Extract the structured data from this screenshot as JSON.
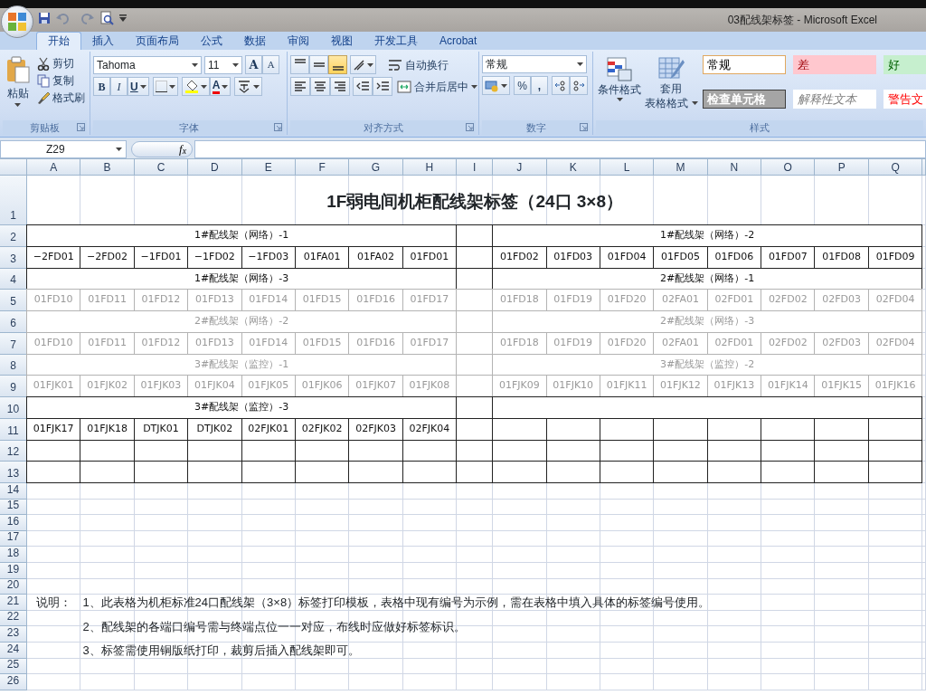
{
  "title_bar": {
    "title": "03配线架标签 - Microsoft Excel"
  },
  "ribbon_tabs": [
    {
      "label": "开始",
      "selected": true
    },
    {
      "label": "插入",
      "selected": false
    },
    {
      "label": "页面布局",
      "selected": false
    },
    {
      "label": "公式",
      "selected": false
    },
    {
      "label": "数据",
      "selected": false
    },
    {
      "label": "审阅",
      "selected": false
    },
    {
      "label": "视图",
      "selected": false
    },
    {
      "label": "开发工具",
      "selected": false
    },
    {
      "label": "Acrobat",
      "selected": false
    }
  ],
  "clipboard": {
    "paste": "粘贴",
    "cut": "剪切",
    "copy": "复制",
    "format_painter": "格式刷",
    "group_label": "剪贴板"
  },
  "font": {
    "font_name": "Tahoma",
    "font_size": "11",
    "grow": "A",
    "shrink": "A",
    "bold": "B",
    "italic": "I",
    "underline": "U",
    "font_color": "A",
    "group_label": "字体"
  },
  "alignment": {
    "vertical_align": [
      {
        "selected": false
      },
      {
        "selected": false
      },
      {
        "selected": true
      }
    ],
    "wrap_text": "自动换行",
    "merge_center": "合并后居中",
    "group_label": "对齐方式"
  },
  "number": {
    "format": "常规",
    "percent": "%",
    "comma": ",",
    "group_label": "数字"
  },
  "styles": {
    "conditional_formatting": "条件格式",
    "format_as_table": [
      "套用",
      "表格格式"
    ],
    "cell_styles": [
      {
        "label": "常规",
        "kind": "normal"
      },
      {
        "label": "差",
        "kind": "bad"
      },
      {
        "label": "好",
        "kind": "good"
      },
      {
        "label": "检查单元格",
        "kind": "check"
      },
      {
        "label": "解释性文本",
        "kind": "explanatory"
      },
      {
        "label": "警告文",
        "kind": "warning"
      }
    ],
    "group_label": "样式"
  },
  "formula_bar": {
    "name_box": "Z29",
    "fx": "f$_{x}$"
  },
  "sheet": {
    "columns": [
      "A",
      "B",
      "C",
      "D",
      "E",
      "F",
      "G",
      "H",
      "I",
      "J",
      "K",
      "L",
      "M",
      "N",
      "O",
      "P",
      "Q"
    ],
    "row_numbers": [
      "1",
      "2",
      "3",
      "4",
      "5",
      "6",
      "7",
      "8",
      "9",
      "10",
      "11",
      "12",
      "13",
      "14",
      "15",
      "16",
      "17",
      "18",
      "19",
      "20",
      "21",
      "22",
      "23",
      "24",
      "25",
      "26"
    ],
    "title": "1F弱电间机柜配线架标签（24口 3×8）",
    "rows": [
      {
        "kind": "header",
        "faded": false,
        "left": "1#配线架（网络）-1",
        "right": "1#配线架（网络）-2"
      },
      {
        "kind": "labels",
        "faded": false,
        "left": [
          "−2FD01",
          "−2FD02",
          "−1FD01",
          "−1FD02",
          "−1FD03",
          "01FA01",
          "01FA02",
          "01FD01"
        ],
        "right": [
          "01FD02",
          "01FD03",
          "01FD04",
          "01FD05",
          "01FD06",
          "01FD07",
          "01FD08",
          "01FD09"
        ]
      },
      {
        "kind": "header",
        "faded": false,
        "left": "1#配线架（网络）-3",
        "right": "2#配线架（网络）-1"
      },
      {
        "kind": "labels",
        "faded": true,
        "left": [
          "01FD10",
          "01FD11",
          "01FD12",
          "01FD13",
          "01FD14",
          "01FD15",
          "01FD16",
          "01FD17"
        ],
        "right": [
          "01FD18",
          "01FD19",
          "01FD20",
          "02FA01",
          "02FD01",
          "02FD02",
          "02FD03",
          "02FD04"
        ]
      },
      {
        "kind": "header",
        "faded": true,
        "left": "2#配线架（网络）-2",
        "right": "2#配线架（网络）-3"
      },
      {
        "kind": "labels",
        "faded": true,
        "left": [
          "01FD10",
          "01FD11",
          "01FD12",
          "01FD13",
          "01FD14",
          "01FD15",
          "01FD16",
          "01FD17"
        ],
        "right": [
          "01FD18",
          "01FD19",
          "01FD20",
          "02FA01",
          "02FD01",
          "02FD02",
          "02FD03",
          "02FD04"
        ]
      },
      {
        "kind": "header",
        "faded": true,
        "left": "3#配线架（监控）-1",
        "right": "3#配线架（监控）-2"
      },
      {
        "kind": "labels",
        "faded": true,
        "left": [
          "01FJK01",
          "01FJK02",
          "01FJK03",
          "01FJK04",
          "01FJK05",
          "01FJK06",
          "01FJK07",
          "01FJK08"
        ],
        "right": [
          "01FJK09",
          "01FJK10",
          "01FJK11",
          "01FJK12",
          "01FJK13",
          "01FJK14",
          "01FJK15",
          "01FJK16"
        ]
      },
      {
        "kind": "header",
        "faded": false,
        "left": "3#配线架（监控）-3"
      },
      {
        "kind": "labels",
        "faded": false,
        "left": [
          "01FJK17",
          "01FJK18",
          "DTJK01",
          "DTJK02",
          "02FJK01",
          "02FJK02",
          "02FJK03",
          "02FJK04"
        ]
      },
      {
        "kind": "labels",
        "faded": false
      },
      {
        "kind": "labels",
        "faded": false
      }
    ],
    "notes": {
      "label": "说明：",
      "lines": [
        "1、此表格为机柜标准24口配线架（3×8）标签打印模板，表格中现有编号为示例，需在表格中填入具体的标签编号使用。",
        "2、配线架的各端口编号需与终端点位一一对应，布线时应做好标签标识。",
        "3、标签需使用铜版纸打印，裁剪后插入配线架即可。"
      ]
    }
  }
}
